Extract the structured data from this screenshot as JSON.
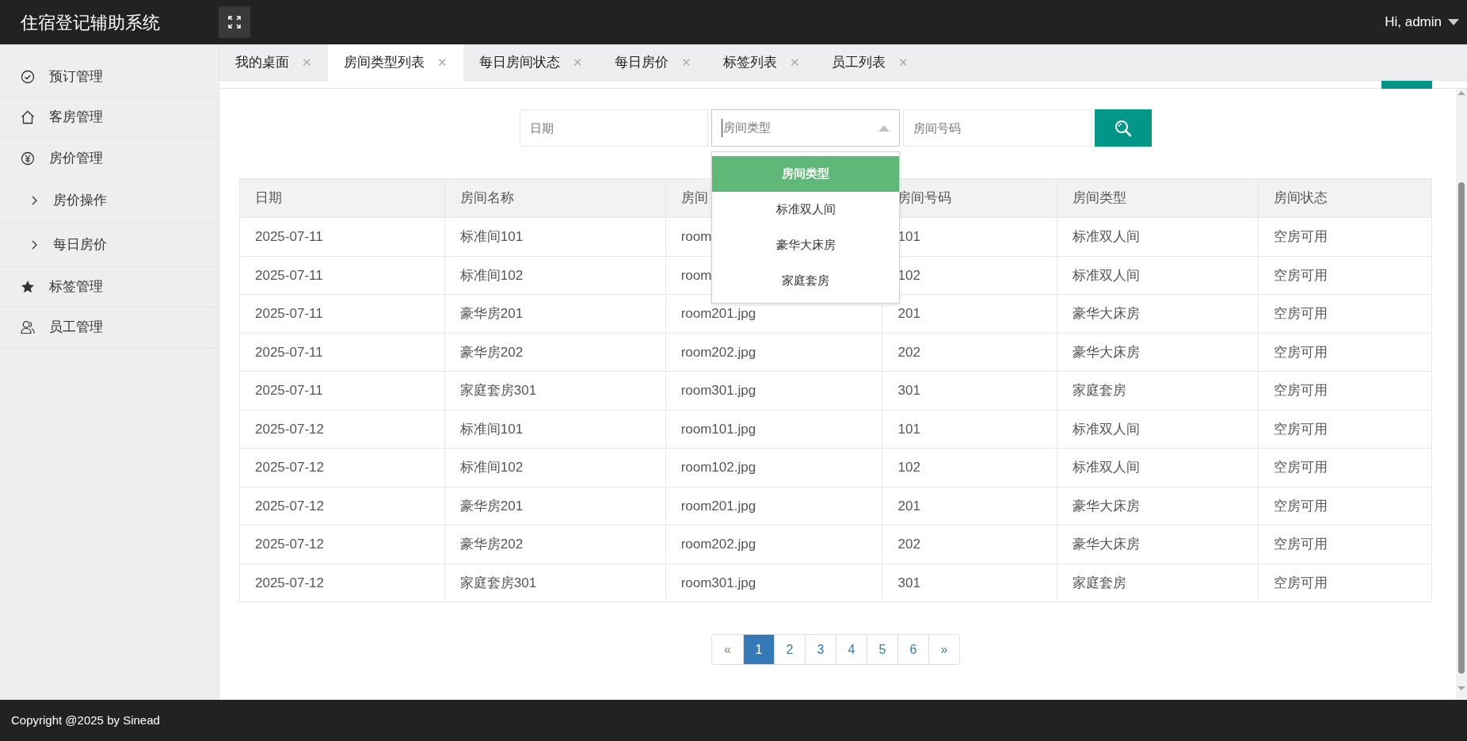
{
  "header": {
    "title": "住宿登记辅助系统",
    "user": "Hi, admin"
  },
  "sidebar": {
    "items": [
      {
        "label": "预订管理"
      },
      {
        "label": "客房管理"
      },
      {
        "label": "房价管理",
        "children": [
          {
            "label": "房价操作"
          },
          {
            "label": "每日房价"
          }
        ]
      },
      {
        "label": "标签管理"
      },
      {
        "label": "员工管理"
      }
    ]
  },
  "tabs": [
    {
      "label": "我的桌面",
      "selected": false,
      "close": "✕"
    },
    {
      "label": "房间类型列表",
      "selected": true,
      "close": "✕"
    },
    {
      "label": "每日房间状态",
      "selected": false,
      "close": "✕"
    },
    {
      "label": "每日房价",
      "selected": false,
      "close": "✕"
    },
    {
      "label": "标签列表",
      "selected": false,
      "close": "✕"
    },
    {
      "label": "员工列表",
      "selected": false,
      "close": "✕"
    }
  ],
  "search": {
    "date": {
      "placeholder": "日期"
    },
    "room_type": {
      "placeholder": "房间类型",
      "expanded": true,
      "options": [
        {
          "label": "房间类型",
          "selected": true
        },
        {
          "label": "标准双人间",
          "selected": false
        },
        {
          "label": "豪华大床房",
          "selected": false
        },
        {
          "label": "家庭套房",
          "selected": false
        }
      ]
    },
    "room_number": {
      "placeholder": "房间号码"
    }
  },
  "table": {
    "columns": [
      "日期",
      "房间名称",
      "房间",
      "房间号码",
      "房间类型",
      "房间状态"
    ],
    "rows": [
      [
        "2025-07-11",
        "标准间101",
        "room",
        "101",
        "标准双人间",
        "空房可用"
      ],
      [
        "2025-07-11",
        "标准间102",
        "room",
        "102",
        "标准双人间",
        "空房可用"
      ],
      [
        "2025-07-11",
        "豪华房201",
        "room201.jpg",
        "201",
        "豪华大床房",
        "空房可用"
      ],
      [
        "2025-07-11",
        "豪华房202",
        "room202.jpg",
        "202",
        "豪华大床房",
        "空房可用"
      ],
      [
        "2025-07-11",
        "家庭套房301",
        "room301.jpg",
        "301",
        "家庭套房",
        "空房可用"
      ],
      [
        "2025-07-12",
        "标准间101",
        "room101.jpg",
        "101",
        "标准双人间",
        "空房可用"
      ],
      [
        "2025-07-12",
        "标准间102",
        "room102.jpg",
        "102",
        "标准双人间",
        "空房可用"
      ],
      [
        "2025-07-12",
        "豪华房201",
        "room201.jpg",
        "201",
        "豪华大床房",
        "空房可用"
      ],
      [
        "2025-07-12",
        "豪华房202",
        "room202.jpg",
        "202",
        "豪华大床房",
        "空房可用"
      ],
      [
        "2025-07-12",
        "家庭套房301",
        "room301.jpg",
        "301",
        "家庭套房",
        "空房可用"
      ]
    ]
  },
  "pagination": {
    "prev": {
      "label": "«",
      "disabled": true
    },
    "pages": [
      {
        "label": "1",
        "selected": true
      },
      {
        "label": "2",
        "selected": false
      },
      {
        "label": "3",
        "selected": false
      },
      {
        "label": "4",
        "selected": false
      },
      {
        "label": "5",
        "selected": false
      },
      {
        "label": "6",
        "selected": false
      }
    ],
    "next": {
      "label": "»",
      "disabled": false
    }
  },
  "footer": {
    "text": "Copyright @2025 by Sinead"
  }
}
